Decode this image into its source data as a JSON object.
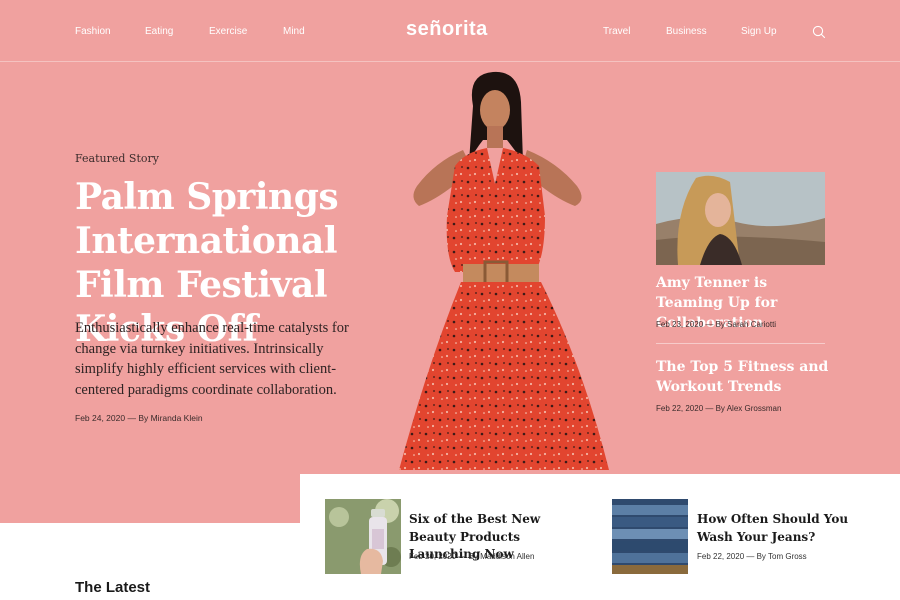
{
  "brand": {
    "logo": "señorita"
  },
  "nav": {
    "left": [
      "Fashion",
      "Eating",
      "Exercise",
      "Mind"
    ],
    "right": [
      "Travel",
      "Business",
      "Sign Up"
    ]
  },
  "icons": {
    "search": "search-icon"
  },
  "featured": {
    "label": "Featured Story",
    "title": "Palm Springs International Film Festival Kicks Off",
    "excerpt": "Enthusiastically enhance real-time catalysts for change via turnkey initiatives. Intrinsically simplify highly efficient services with client-centered paradigms coordinate collaboration.",
    "meta": "Feb 24, 2020 — By Miranda Klein"
  },
  "side_stories": [
    {
      "title": "Amy Tenner is Teaming Up for Collaboration",
      "meta": "Feb 23, 2020 — By Sarah Cariotti"
    },
    {
      "title": "The Top 5 Fitness and Workout Trends",
      "meta": "Feb 22, 2020 — By Alex Grossman"
    }
  ],
  "cards": [
    {
      "title": "Six of the Best New Beauty Products Launching Now",
      "meta": "Feb 20, 2020 — By Maddison Allen"
    },
    {
      "title": "How Often Should You Wash Your Jeans?",
      "meta": "Feb 22, 2020 — By Tom Gross"
    }
  ],
  "sections": {
    "latest": "The Latest"
  },
  "colors": {
    "hero_background": "#f0a19f",
    "dress": "#e2452f",
    "text_light": "#ffffff",
    "text_dark": "#2e2323"
  }
}
